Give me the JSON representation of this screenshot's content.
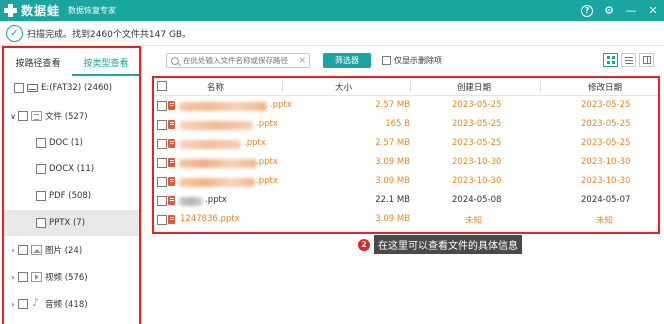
{
  "titlebar": {
    "app_name": "数据蛙",
    "subtitle": "数据恢复专家",
    "help_icon": "?",
    "gear_icon": "⚙",
    "minimize_icon": "—",
    "close_icon": "✕"
  },
  "status": {
    "text": "扫描完成。找到2460个文件共147 GB。"
  },
  "sidebar": {
    "tabs": [
      {
        "label": "按路径查看",
        "active": false
      },
      {
        "label": "按类型查看",
        "active": true
      }
    ],
    "tree": [
      {
        "label": "E:(FAT32) (2460)",
        "icon": "drive-icon",
        "level": 0,
        "caret": ""
      },
      {
        "label": "文件 (527)",
        "icon": "document-icon",
        "level": 1,
        "caret": "expanded"
      },
      {
        "label": "DOC (1)",
        "level": 2
      },
      {
        "label": "DOCX (11)",
        "level": 2
      },
      {
        "label": "PDF (508)",
        "level": 2
      },
      {
        "label": "PPTX (7)",
        "level": 2,
        "selected": true
      },
      {
        "label": "图片 (24)",
        "icon": "image-icon",
        "level": 1,
        "caret": "collapsed"
      },
      {
        "label": "视频 (576)",
        "icon": "video-icon",
        "level": 1,
        "caret": "collapsed"
      },
      {
        "label": "音频 (418)",
        "icon": "audio-icon",
        "level": 1,
        "caret": "collapsed"
      }
    ]
  },
  "toolbar": {
    "search_placeholder": "在此处输入文件名称或保存路径",
    "clear_icon": "×",
    "filter_label": "筛选器",
    "only_deleted_label": "仅显示删除项"
  },
  "table": {
    "headers": {
      "name": "名称",
      "size": "大小",
      "created": "创建日期",
      "modified": "修改日期"
    },
    "rows": [
      {
        "name": ".pptx",
        "size": "2.57 MB",
        "created": "2023-05-25",
        "modified": "2023-05-25",
        "status": "deleted"
      },
      {
        "name": ".pptx",
        "size": "165  B",
        "created": "2023-05-25",
        "modified": "2023-05-25",
        "status": "deleted"
      },
      {
        "name": ".pptx",
        "size": "2.57 MB",
        "created": "2023-05-25",
        "modified": "2023-05-25",
        "status": "deleted"
      },
      {
        "name": ".pptx",
        "size": "3.09 MB",
        "created": "2023-10-30",
        "modified": "2023-10-30",
        "status": "deleted"
      },
      {
        "name": ".pptx",
        "size": "3.09 MB",
        "created": "2023-10-30",
        "modified": "2023-10-30",
        "status": "deleted"
      },
      {
        "name": ".pptx",
        "size": "22.1 MB",
        "created": "2024-05-08",
        "modified": "2024-05-07",
        "status": "normal"
      },
      {
        "name": "1247836.pptx",
        "size": "3.09 MB",
        "created": "未知",
        "modified": "未知",
        "status": "deleted"
      }
    ]
  },
  "annotation": {
    "number": "2",
    "text": "在这里可以查看文件的具体信息"
  },
  "colors": {
    "brand": "#1aa6a0",
    "deleted_text": "#e8861e",
    "highlight_frame": "#e8231f"
  }
}
